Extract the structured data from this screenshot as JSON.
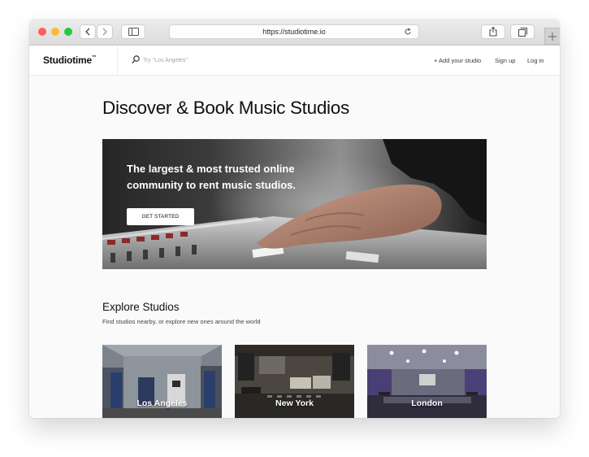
{
  "browser": {
    "url": "https://studiotime.io",
    "icons": {
      "back": "chevron-left-icon",
      "forward": "chevron-right-icon",
      "sidebar": "sidebar-icon",
      "reload": "reload-icon",
      "share": "share-icon",
      "tabs": "tabs-icon",
      "new_tab": "plus-icon"
    }
  },
  "topnav": {
    "logo": "Studiotime",
    "logo_mark": "™",
    "search_placeholder": "Try \"Los Angeles\"",
    "links": [
      "+ Add your studio",
      "Sign up",
      "Log in"
    ]
  },
  "main": {
    "title": "Discover & Book Music Studios",
    "hero": {
      "heading": "The largest & most trusted online community to rent music studios.",
      "button": "GET STARTED"
    },
    "explore": {
      "title": "Explore Studios",
      "subtitle": "Find studios nearby, or explore new ones around the world",
      "cities": [
        "Los Angeles",
        "New York",
        "London"
      ]
    }
  },
  "colors": {
    "traffic_red": "#fc5f57",
    "traffic_yellow": "#fdbc2e",
    "traffic_green": "#28c840",
    "page_background": "#fafafa",
    "text_primary": "#111111"
  }
}
